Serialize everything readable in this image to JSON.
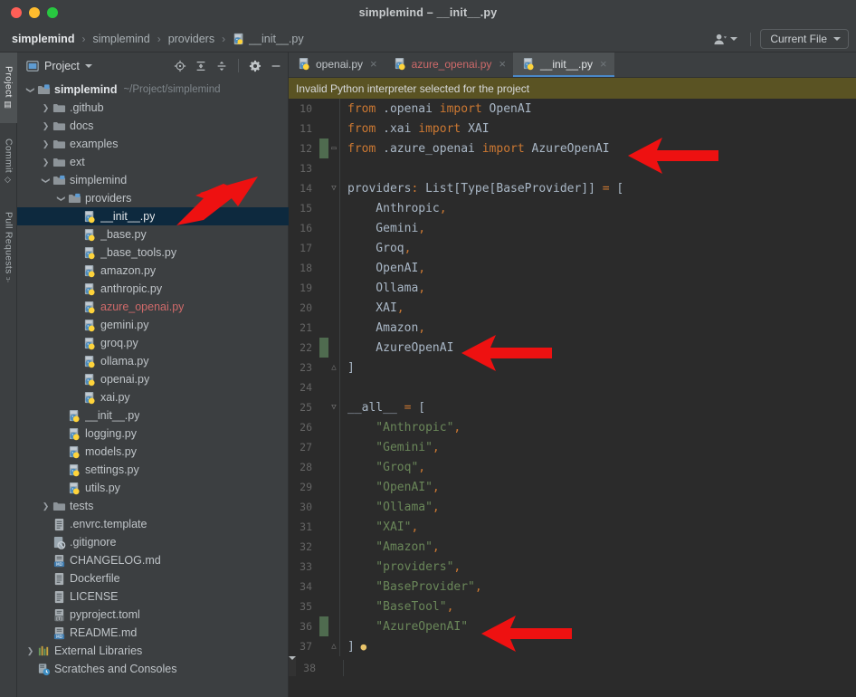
{
  "window": {
    "title": "simplemind – __init__.py",
    "traffic_lights": [
      "close",
      "minimize",
      "zoom"
    ]
  },
  "breadcrumb": {
    "items": [
      {
        "label": "simplemind",
        "icon": null,
        "bold": true
      },
      {
        "label": "simplemind",
        "icon": null,
        "bold": false
      },
      {
        "label": "providers",
        "icon": null,
        "bold": false
      },
      {
        "label": "__init__.py",
        "icon": "python-file-icon",
        "bold": false
      }
    ],
    "separator": "›"
  },
  "nav_right": {
    "account_icon": "user-account-icon",
    "run_config_label": "Current File",
    "dropdown_icon": "chevron-down-icon"
  },
  "tool_stripe": {
    "items": [
      {
        "label": "Project",
        "icon": "project-icon",
        "active": true
      },
      {
        "label": "Commit",
        "icon": "commit-icon",
        "active": false
      },
      {
        "label": "Pull Requests",
        "icon": "pull-request-icon",
        "active": false
      }
    ]
  },
  "project_panel": {
    "title": "Project",
    "title_icon": "project-window-icon",
    "dropdown_icon": "chevron-down-icon",
    "toolbar_icons": [
      "locate-in-tree-icon",
      "expand-all-icon",
      "collapse-all-icon",
      "settings-gear-icon",
      "hide-panel-icon"
    ],
    "tree": [
      {
        "indent": 0,
        "twisty": "down",
        "icon": "folder-module-icon",
        "label": "simplemind",
        "sublabel": "~/Project/simplemind",
        "bold": true,
        "red": false,
        "selected": false
      },
      {
        "indent": 1,
        "twisty": "right",
        "icon": "folder-icon",
        "label": ".github",
        "sublabel": "",
        "bold": false,
        "red": false,
        "selected": false
      },
      {
        "indent": 1,
        "twisty": "right",
        "icon": "folder-icon",
        "label": "docs",
        "sublabel": "",
        "bold": false,
        "red": false,
        "selected": false
      },
      {
        "indent": 1,
        "twisty": "right",
        "icon": "folder-icon",
        "label": "examples",
        "sublabel": "",
        "bold": false,
        "red": false,
        "selected": false
      },
      {
        "indent": 1,
        "twisty": "right",
        "icon": "folder-icon",
        "label": "ext",
        "sublabel": "",
        "bold": false,
        "red": false,
        "selected": false
      },
      {
        "indent": 1,
        "twisty": "down",
        "icon": "folder-source-icon",
        "label": "simplemind",
        "sublabel": "",
        "bold": false,
        "red": false,
        "selected": false
      },
      {
        "indent": 2,
        "twisty": "down",
        "icon": "folder-source-icon",
        "label": "providers",
        "sublabel": "",
        "bold": false,
        "red": false,
        "selected": false
      },
      {
        "indent": 3,
        "twisty": "none",
        "icon": "python-file-icon",
        "label": "__init__.py",
        "sublabel": "",
        "bold": false,
        "red": false,
        "selected": true
      },
      {
        "indent": 3,
        "twisty": "none",
        "icon": "python-file-icon",
        "label": "_base.py",
        "sublabel": "",
        "bold": false,
        "red": false,
        "selected": false
      },
      {
        "indent": 3,
        "twisty": "none",
        "icon": "python-file-icon",
        "label": "_base_tools.py",
        "sublabel": "",
        "bold": false,
        "red": false,
        "selected": false
      },
      {
        "indent": 3,
        "twisty": "none",
        "icon": "python-file-icon",
        "label": "amazon.py",
        "sublabel": "",
        "bold": false,
        "red": false,
        "selected": false
      },
      {
        "indent": 3,
        "twisty": "none",
        "icon": "python-file-icon",
        "label": "anthropic.py",
        "sublabel": "",
        "bold": false,
        "red": false,
        "selected": false
      },
      {
        "indent": 3,
        "twisty": "none",
        "icon": "python-file-icon",
        "label": "azure_openai.py",
        "sublabel": "",
        "bold": false,
        "red": true,
        "selected": false
      },
      {
        "indent": 3,
        "twisty": "none",
        "icon": "python-file-icon",
        "label": "gemini.py",
        "sublabel": "",
        "bold": false,
        "red": false,
        "selected": false
      },
      {
        "indent": 3,
        "twisty": "none",
        "icon": "python-file-icon",
        "label": "groq.py",
        "sublabel": "",
        "bold": false,
        "red": false,
        "selected": false
      },
      {
        "indent": 3,
        "twisty": "none",
        "icon": "python-file-icon",
        "label": "ollama.py",
        "sublabel": "",
        "bold": false,
        "red": false,
        "selected": false
      },
      {
        "indent": 3,
        "twisty": "none",
        "icon": "python-file-icon",
        "label": "openai.py",
        "sublabel": "",
        "bold": false,
        "red": false,
        "selected": false
      },
      {
        "indent": 3,
        "twisty": "none",
        "icon": "python-file-icon",
        "label": "xai.py",
        "sublabel": "",
        "bold": false,
        "red": false,
        "selected": false
      },
      {
        "indent": 2,
        "twisty": "none",
        "icon": "python-file-icon",
        "label": "__init__.py",
        "sublabel": "",
        "bold": false,
        "red": false,
        "selected": false
      },
      {
        "indent": 2,
        "twisty": "none",
        "icon": "python-file-icon",
        "label": "logging.py",
        "sublabel": "",
        "bold": false,
        "red": false,
        "selected": false
      },
      {
        "indent": 2,
        "twisty": "none",
        "icon": "python-file-icon",
        "label": "models.py",
        "sublabel": "",
        "bold": false,
        "red": false,
        "selected": false
      },
      {
        "indent": 2,
        "twisty": "none",
        "icon": "python-file-icon",
        "label": "settings.py",
        "sublabel": "",
        "bold": false,
        "red": false,
        "selected": false
      },
      {
        "indent": 2,
        "twisty": "none",
        "icon": "python-file-icon",
        "label": "utils.py",
        "sublabel": "",
        "bold": false,
        "red": false,
        "selected": false
      },
      {
        "indent": 1,
        "twisty": "right",
        "icon": "folder-icon",
        "label": "tests",
        "sublabel": "",
        "bold": false,
        "red": false,
        "selected": false
      },
      {
        "indent": 1,
        "twisty": "none",
        "icon": "text-file-icon",
        "label": ".envrc.template",
        "sublabel": "",
        "bold": false,
        "red": false,
        "selected": false
      },
      {
        "indent": 1,
        "twisty": "none",
        "icon": "gitignore-icon",
        "label": ".gitignore",
        "sublabel": "",
        "bold": false,
        "red": false,
        "selected": false
      },
      {
        "indent": 1,
        "twisty": "none",
        "icon": "markdown-file-icon",
        "label": "CHANGELOG.md",
        "sublabel": "",
        "bold": false,
        "red": false,
        "selected": false
      },
      {
        "indent": 1,
        "twisty": "none",
        "icon": "text-file-icon",
        "label": "Dockerfile",
        "sublabel": "",
        "bold": false,
        "red": false,
        "selected": false
      },
      {
        "indent": 1,
        "twisty": "none",
        "icon": "text-file-icon",
        "label": "LICENSE",
        "sublabel": "",
        "bold": false,
        "red": false,
        "selected": false
      },
      {
        "indent": 1,
        "twisty": "none",
        "icon": "toml-file-icon",
        "label": "pyproject.toml",
        "sublabel": "",
        "bold": false,
        "red": false,
        "selected": false
      },
      {
        "indent": 1,
        "twisty": "none",
        "icon": "markdown-file-icon",
        "label": "README.md",
        "sublabel": "",
        "bold": false,
        "red": false,
        "selected": false
      },
      {
        "indent": 0,
        "twisty": "right",
        "icon": "external-libraries-icon",
        "label": "External Libraries",
        "sublabel": "",
        "bold": false,
        "red": false,
        "selected": false
      },
      {
        "indent": 0,
        "twisty": "none",
        "icon": "scratches-icon",
        "label": "Scratches and Consoles",
        "sublabel": "",
        "bold": false,
        "red": false,
        "selected": false
      }
    ]
  },
  "editor": {
    "tabs": [
      {
        "label": "openai.py",
        "icon": "python-file-icon",
        "active": false,
        "error": false,
        "close_icon": "close-icon"
      },
      {
        "label": "azure_openai.py",
        "icon": "python-file-icon",
        "active": false,
        "error": true,
        "close_icon": "close-icon"
      },
      {
        "label": "__init__.py",
        "icon": "python-file-icon",
        "active": true,
        "error": false,
        "close_icon": "close-icon"
      }
    ],
    "banner": "Invalid Python interpreter selected for the project",
    "lines": [
      {
        "num": "10",
        "added": false,
        "fold": "",
        "caret": false,
        "tokens": [
          {
            "t": "kw",
            "v": "from"
          },
          {
            "t": "plain",
            "v": " .openai "
          },
          {
            "t": "kw",
            "v": "import"
          },
          {
            "t": "plain",
            "v": " OpenAI"
          }
        ]
      },
      {
        "num": "11",
        "added": false,
        "fold": "",
        "caret": false,
        "tokens": [
          {
            "t": "kw",
            "v": "from"
          },
          {
            "t": "plain",
            "v": " .xai "
          },
          {
            "t": "kw",
            "v": "import"
          },
          {
            "t": "plain",
            "v": " XAI"
          }
        ]
      },
      {
        "num": "12",
        "added": true,
        "fold": "-",
        "caret": false,
        "tokens": [
          {
            "t": "kw",
            "v": "from"
          },
          {
            "t": "plain",
            "v": " .azure_openai "
          },
          {
            "t": "kw",
            "v": "import"
          },
          {
            "t": "plain",
            "v": " AzureOpenAI"
          }
        ]
      },
      {
        "num": "13",
        "added": false,
        "fold": "",
        "caret": false,
        "tokens": []
      },
      {
        "num": "14",
        "added": false,
        "fold": "v",
        "caret": false,
        "tokens": [
          {
            "t": "plain",
            "v": "providers"
          },
          {
            "t": "punc",
            "v": ":"
          },
          {
            "t": "plain",
            "v": " List[Type[BaseProvider]] "
          },
          {
            "t": "punc",
            "v": "="
          },
          {
            "t": "plain",
            "v": " ["
          }
        ]
      },
      {
        "num": "15",
        "added": false,
        "fold": "",
        "caret": false,
        "tokens": [
          {
            "t": "plain",
            "v": "    Anthropic"
          },
          {
            "t": "punc",
            "v": ","
          }
        ]
      },
      {
        "num": "16",
        "added": false,
        "fold": "",
        "caret": false,
        "tokens": [
          {
            "t": "plain",
            "v": "    Gemini"
          },
          {
            "t": "punc",
            "v": ","
          }
        ]
      },
      {
        "num": "17",
        "added": false,
        "fold": "",
        "caret": false,
        "tokens": [
          {
            "t": "plain",
            "v": "    Groq"
          },
          {
            "t": "punc",
            "v": ","
          }
        ]
      },
      {
        "num": "18",
        "added": false,
        "fold": "",
        "caret": false,
        "tokens": [
          {
            "t": "plain",
            "v": "    OpenAI"
          },
          {
            "t": "punc",
            "v": ","
          }
        ]
      },
      {
        "num": "19",
        "added": false,
        "fold": "",
        "caret": false,
        "tokens": [
          {
            "t": "plain",
            "v": "    Ollama"
          },
          {
            "t": "punc",
            "v": ","
          }
        ]
      },
      {
        "num": "20",
        "added": false,
        "fold": "",
        "caret": false,
        "tokens": [
          {
            "t": "plain",
            "v": "    XAI"
          },
          {
            "t": "punc",
            "v": ","
          }
        ]
      },
      {
        "num": "21",
        "added": false,
        "fold": "",
        "caret": false,
        "tokens": [
          {
            "t": "plain",
            "v": "    Amazon"
          },
          {
            "t": "punc",
            "v": ","
          }
        ]
      },
      {
        "num": "22",
        "added": true,
        "fold": "",
        "caret": false,
        "tokens": [
          {
            "t": "plain",
            "v": "    AzureOpenAI"
          }
        ]
      },
      {
        "num": "23",
        "added": false,
        "fold": "^",
        "caret": false,
        "tokens": [
          {
            "t": "plain",
            "v": "]"
          }
        ]
      },
      {
        "num": "24",
        "added": false,
        "fold": "",
        "caret": false,
        "tokens": []
      },
      {
        "num": "25",
        "added": false,
        "fold": "v",
        "caret": false,
        "tokens": [
          {
            "t": "plain",
            "v": "__all__ "
          },
          {
            "t": "punc",
            "v": "="
          },
          {
            "t": "plain",
            "v": " ["
          }
        ]
      },
      {
        "num": "26",
        "added": false,
        "fold": "",
        "caret": false,
        "tokens": [
          {
            "t": "str",
            "v": "    \"Anthropic\""
          },
          {
            "t": "punc",
            "v": ","
          }
        ]
      },
      {
        "num": "27",
        "added": false,
        "fold": "",
        "caret": false,
        "tokens": [
          {
            "t": "str",
            "v": "    \"Gemini\""
          },
          {
            "t": "punc",
            "v": ","
          }
        ]
      },
      {
        "num": "28",
        "added": false,
        "fold": "",
        "caret": false,
        "tokens": [
          {
            "t": "str",
            "v": "    \"Groq\""
          },
          {
            "t": "punc",
            "v": ","
          }
        ]
      },
      {
        "num": "29",
        "added": false,
        "fold": "",
        "caret": false,
        "tokens": [
          {
            "t": "str",
            "v": "    \"OpenAI\""
          },
          {
            "t": "punc",
            "v": ","
          }
        ]
      },
      {
        "num": "30",
        "added": false,
        "fold": "",
        "caret": false,
        "tokens": [
          {
            "t": "str",
            "v": "    \"Ollama\""
          },
          {
            "t": "punc",
            "v": ","
          }
        ]
      },
      {
        "num": "31",
        "added": false,
        "fold": "",
        "caret": false,
        "tokens": [
          {
            "t": "str",
            "v": "    \"XAI\""
          },
          {
            "t": "punc",
            "v": ","
          }
        ]
      },
      {
        "num": "32",
        "added": false,
        "fold": "",
        "caret": false,
        "tokens": [
          {
            "t": "str",
            "v": "    \"Amazon\""
          },
          {
            "t": "punc",
            "v": ","
          }
        ]
      },
      {
        "num": "33",
        "added": false,
        "fold": "",
        "caret": false,
        "tokens": [
          {
            "t": "str",
            "v": "    \"providers\""
          },
          {
            "t": "punc",
            "v": ","
          }
        ]
      },
      {
        "num": "34",
        "added": false,
        "fold": "",
        "caret": false,
        "tokens": [
          {
            "t": "str",
            "v": "    \"BaseProvider\""
          },
          {
            "t": "punc",
            "v": ","
          }
        ]
      },
      {
        "num": "35",
        "added": false,
        "fold": "",
        "caret": false,
        "tokens": [
          {
            "t": "str",
            "v": "    \"BaseTool\""
          },
          {
            "t": "punc",
            "v": ","
          }
        ]
      },
      {
        "num": "36",
        "added": true,
        "fold": "",
        "caret": false,
        "tokens": [
          {
            "t": "str",
            "v": "    \"AzureOpenAI\""
          }
        ]
      },
      {
        "num": "37",
        "added": false,
        "fold": "^",
        "caret": false,
        "bulb": true,
        "tokens": [
          {
            "t": "plain",
            "v": "]"
          }
        ]
      },
      {
        "num": "38",
        "added": false,
        "fold": "",
        "caret": true,
        "tokens": []
      }
    ]
  },
  "annotations": {
    "color": "#EE1111",
    "arrows": [
      {
        "name": "arrow-pointing-to-tree-init-file",
        "direction": "down-left"
      },
      {
        "name": "arrow-pointing-to-import-line",
        "direction": "left"
      },
      {
        "name": "arrow-pointing-to-provider-entry",
        "direction": "left"
      },
      {
        "name": "arrow-pointing-to-all-entry",
        "direction": "left"
      }
    ]
  }
}
